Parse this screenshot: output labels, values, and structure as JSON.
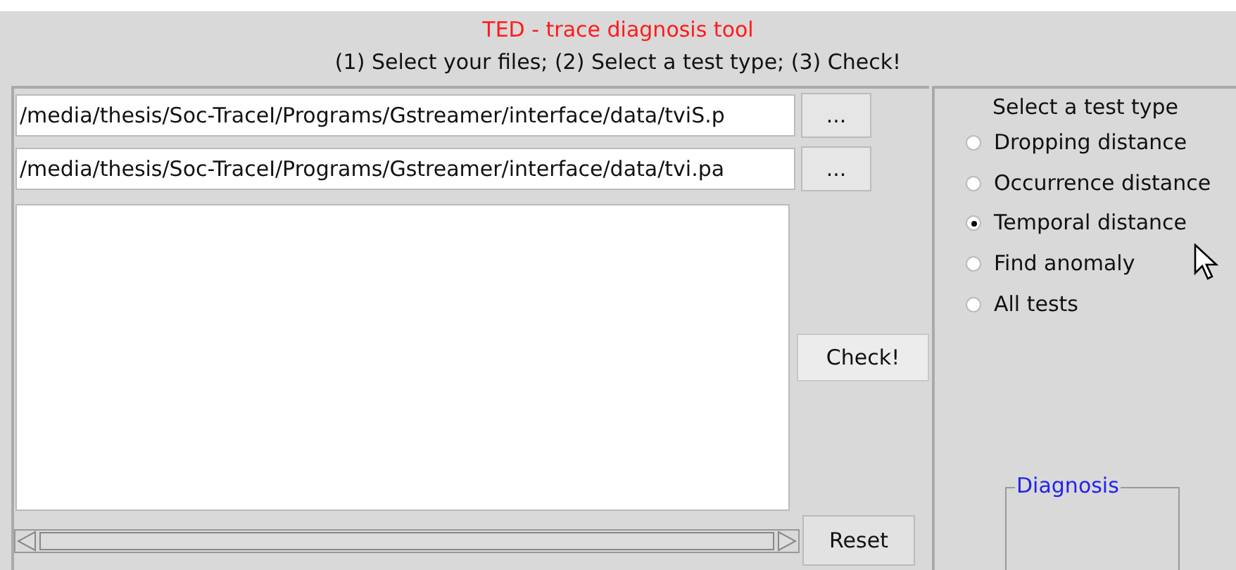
{
  "header": {
    "title": "TED - trace diagnosis tool",
    "instructions": "(1) Select your files; (2) Select a test type; (3) Check!"
  },
  "files": [
    {
      "path": "/media/thesis/Soc-TraceI/Programs/Gstreamer/interface/data/tviS.p",
      "browse": "..."
    },
    {
      "path": "/media/thesis/Soc-TraceI/Programs/Gstreamer/interface/data/tvi.pa",
      "browse": "..."
    }
  ],
  "check_button": "Check!",
  "reset_button": "Reset",
  "test_type": {
    "title": "Select a test type",
    "options": [
      {
        "label": "Dropping distance",
        "selected": false
      },
      {
        "label": "Occurrence distance",
        "selected": false
      },
      {
        "label": "Temporal distance",
        "selected": true
      },
      {
        "label": "Find anomaly",
        "selected": false
      },
      {
        "label": "All tests",
        "selected": false
      }
    ]
  },
  "diagnosis": {
    "title": "Diagnosis"
  }
}
